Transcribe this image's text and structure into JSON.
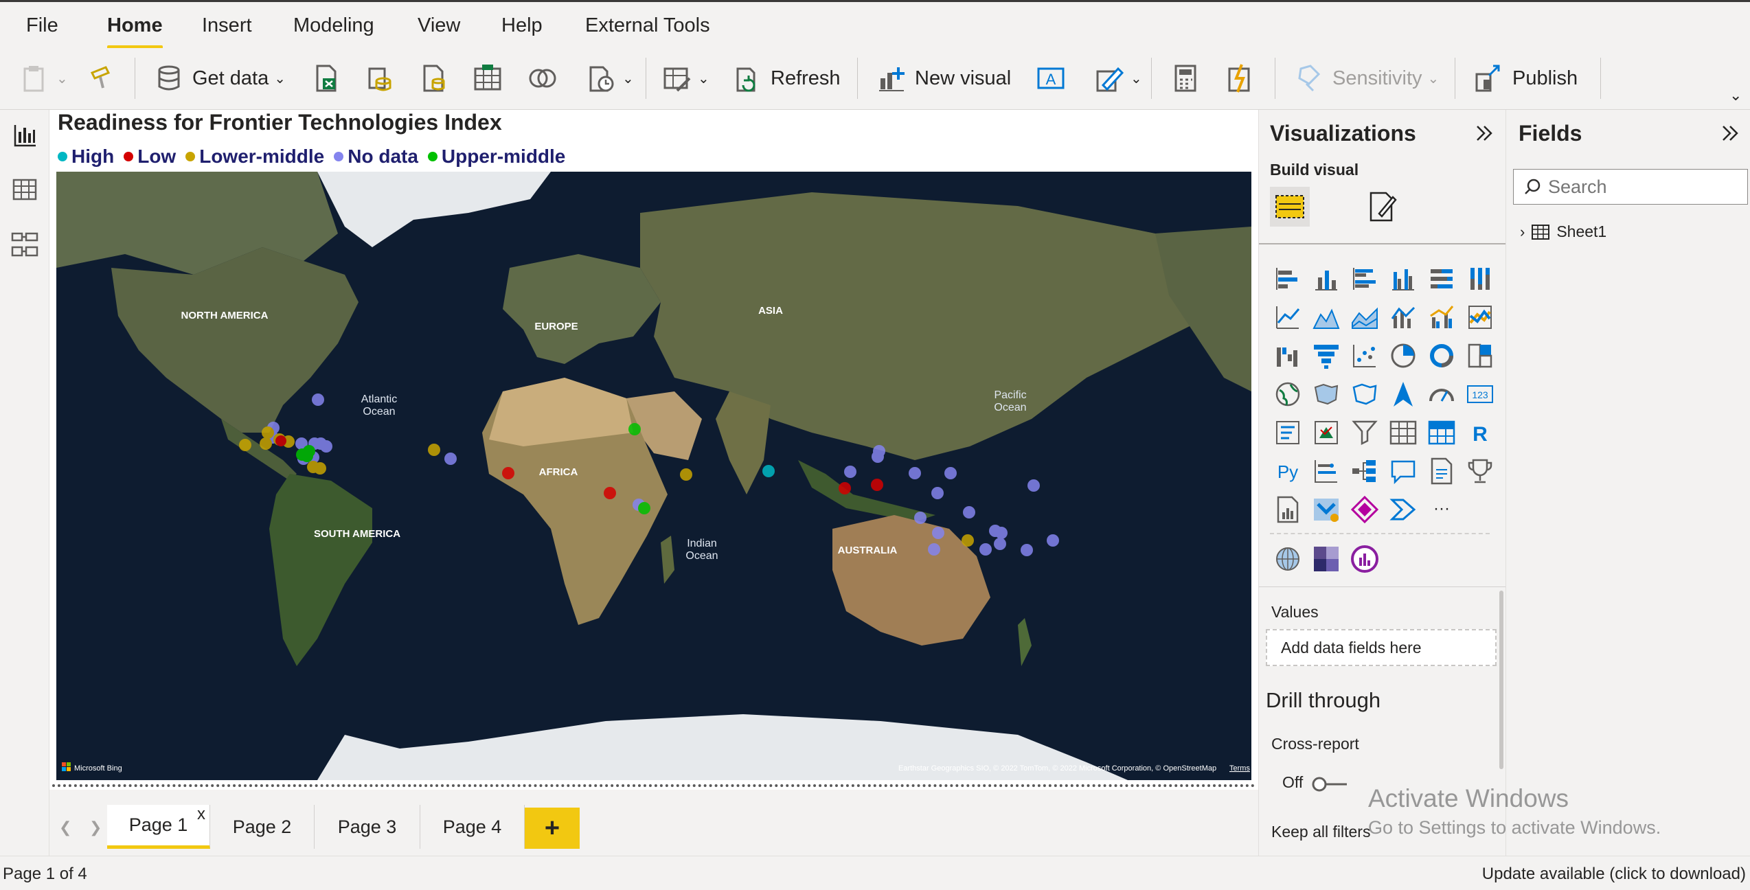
{
  "menu": {
    "items": [
      "File",
      "Home",
      "Insert",
      "Modeling",
      "View",
      "Help",
      "External Tools"
    ],
    "active": "Home"
  },
  "ribbon": {
    "get_data": "Get data",
    "refresh": "Refresh",
    "new_visual": "New visual",
    "sensitivity": "Sensitivity",
    "publish": "Publish"
  },
  "visual": {
    "title": "Readiness for Frontier Technologies Index",
    "legend": [
      {
        "label": "High",
        "color": "#00b7c3"
      },
      {
        "label": "Low",
        "color": "#d40000"
      },
      {
        "label": "Lower-middle",
        "color": "#c8a400"
      },
      {
        "label": "No data",
        "color": "#8484ee"
      },
      {
        "label": "Upper-middle",
        "color": "#00c000"
      }
    ],
    "map_labels": {
      "north_america": "NORTH AMERICA",
      "south_america": "SOUTH AMERICA",
      "europe": "EUROPE",
      "africa": "AFRICA",
      "asia": "ASIA",
      "australia": "AUSTRALIA",
      "atlantic_1": "Atlantic",
      "atlantic_2": "Ocean",
      "pacific_1": "Pacific",
      "pacific_2": "Ocean",
      "indian_1": "Indian",
      "indian_2": "Ocean"
    },
    "bing_logo": "Microsoft Bing",
    "attribution": "Earthstar Geographics SIO, © 2022 TomTom, © 2022 Microsoft Corporation, © OpenStreetMap",
    "terms": "Terms"
  },
  "pages": {
    "tabs": [
      "Page 1",
      "Page 2",
      "Page 3",
      "Page 4"
    ],
    "active": "Page 1",
    "close_glyph": "x",
    "add_glyph": "+"
  },
  "status": {
    "page_count": "Page 1 of 4",
    "update": "Update available (click to download)"
  },
  "viz_pane": {
    "title": "Visualizations",
    "build_visual": "Build visual",
    "values_label": "Values",
    "values_placeholder": "Add data fields here",
    "drill_through": "Drill through",
    "cross_report": "Cross-report",
    "toggle_state": "Off",
    "keep_filters": "Keep all filters",
    "r_glyph": "R",
    "py_glyph": "Py",
    "kpi_glyph": "123",
    "more_glyph": "···"
  },
  "fields_pane": {
    "title": "Fields",
    "search_placeholder": "Search",
    "tables": [
      "Sheet1"
    ]
  },
  "watermark": {
    "title": "Activate Windows",
    "subtitle": "Go to Settings to activate Windows."
  }
}
